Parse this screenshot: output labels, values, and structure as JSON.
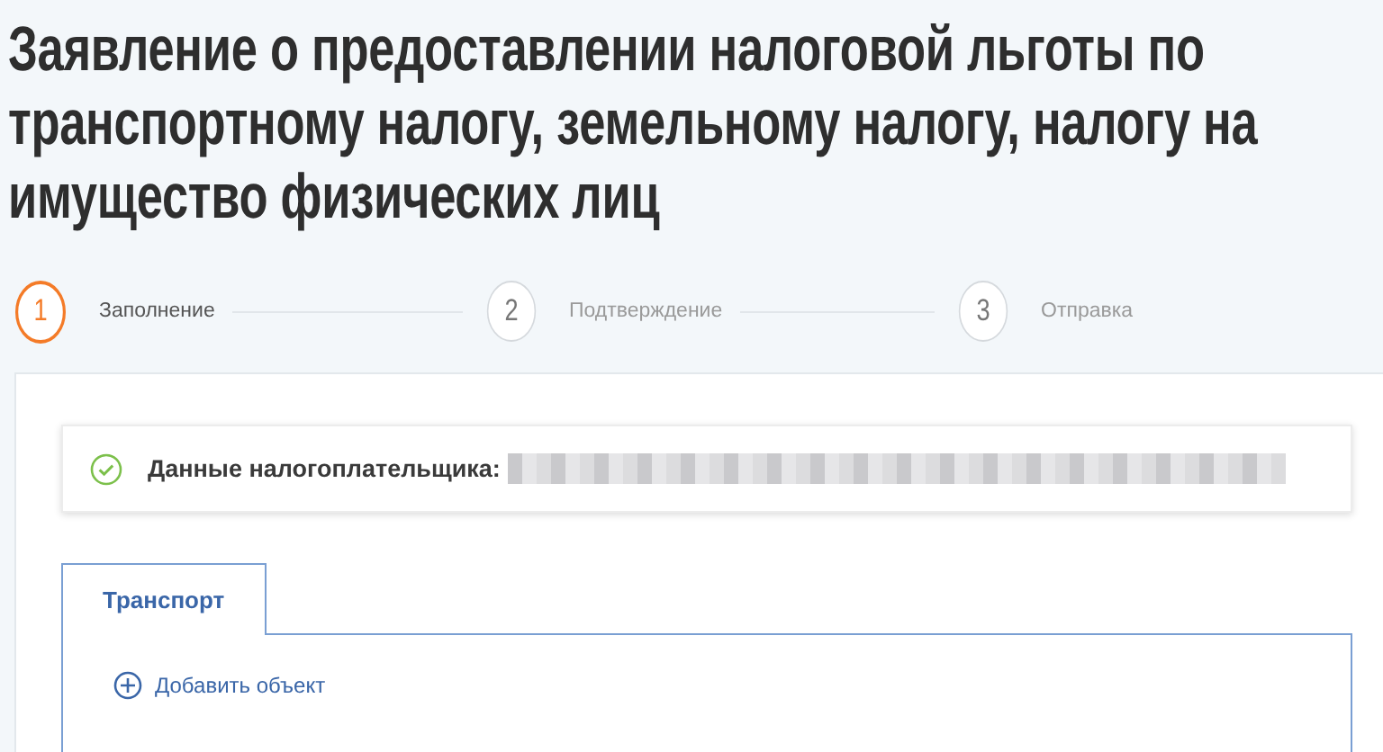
{
  "title": "Заявление о предоставлении налоговой льготы по транспортному налогу, земельному налогу, налогу на имущество физических лиц",
  "steps": [
    {
      "number": "1",
      "label": "Заполнение",
      "selected": true
    },
    {
      "number": "2",
      "label": "Подтверждение",
      "selected": false
    },
    {
      "number": "3",
      "label": "Отправка",
      "selected": false
    }
  ],
  "taxpayer": {
    "label": "Данные налогоплательщика:",
    "verified": true
  },
  "tabs": [
    {
      "label": "Транспорт",
      "selected": true
    }
  ],
  "add_button": {
    "label": "Добавить объект"
  }
}
